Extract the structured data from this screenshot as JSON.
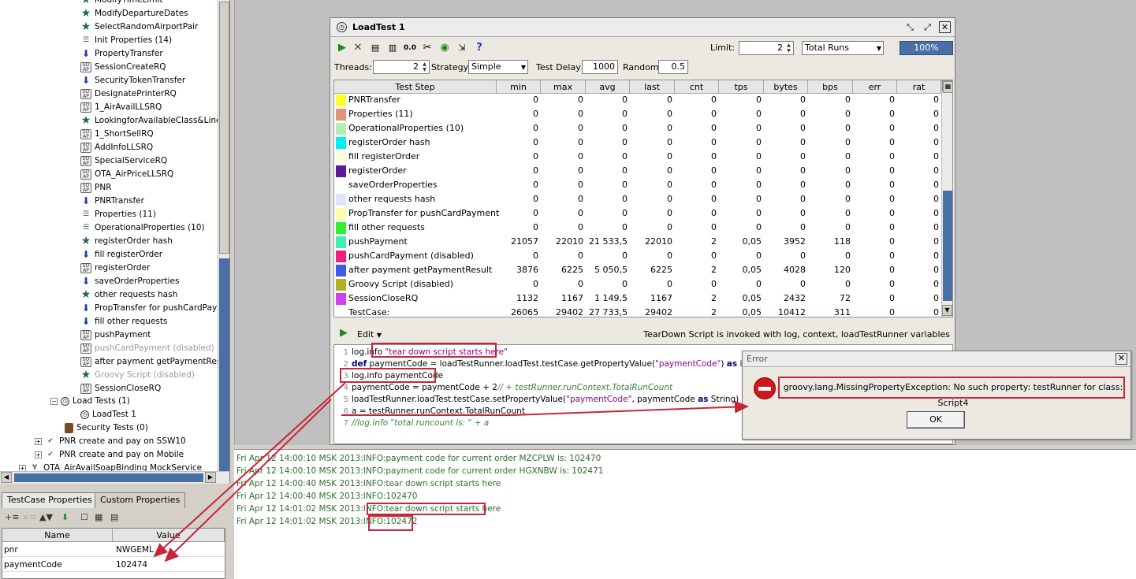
{
  "navigator": {
    "items": [
      {
        "label": "ModifyTimeLimit",
        "icon": "star-icon",
        "state": "normal"
      },
      {
        "label": "ModifyDepartureDates",
        "icon": "star-icon",
        "state": "normal"
      },
      {
        "label": "SelectRandomAirportPair",
        "icon": "star-icon",
        "state": "normal"
      },
      {
        "label": "Init Properties (14)",
        "icon": "properties-icon",
        "state": "normal"
      },
      {
        "label": "PropertyTransfer",
        "icon": "transfer-icon",
        "state": "normal"
      },
      {
        "label": "SessionCreateRQ",
        "icon": "soap-icon",
        "state": "normal"
      },
      {
        "label": "SecurityTokenTransfer",
        "icon": "transfer-icon",
        "state": "normal"
      },
      {
        "label": "DesignatePrinterRQ",
        "icon": "soap-icon",
        "state": "normal"
      },
      {
        "label": "1_AirAvailLLSRQ",
        "icon": "soap-icon",
        "state": "normal"
      },
      {
        "label": "LookingforAvailableClass&Linenu",
        "icon": "star-icon",
        "state": "normal"
      },
      {
        "label": "1_ShortSellRQ",
        "icon": "soap-icon",
        "state": "normal"
      },
      {
        "label": "AddInfoLLSRQ",
        "icon": "soap-icon",
        "state": "normal"
      },
      {
        "label": "SpecialServiceRQ",
        "icon": "soap-icon",
        "state": "normal"
      },
      {
        "label": "OTA_AirPriceLLSRQ",
        "icon": "soap-icon",
        "state": "normal"
      },
      {
        "label": "PNR",
        "icon": "soap-icon",
        "state": "normal"
      },
      {
        "label": "PNRTransfer",
        "icon": "transfer-icon",
        "state": "normal"
      },
      {
        "label": "Properties (11)",
        "icon": "properties-icon",
        "state": "normal"
      },
      {
        "label": "OperationalProperties (10)",
        "icon": "properties-icon",
        "state": "normal"
      },
      {
        "label": "registerOrder hash",
        "icon": "star-icon",
        "state": "normal"
      },
      {
        "label": "fill registerOrder",
        "icon": "transfer-icon",
        "state": "normal"
      },
      {
        "label": "registerOrder",
        "icon": "soap-icon",
        "state": "normal"
      },
      {
        "label": "saveOrderProperties",
        "icon": "transfer-icon",
        "state": "normal"
      },
      {
        "label": "other requests hash",
        "icon": "star-icon",
        "state": "normal"
      },
      {
        "label": "PropTransfer for pushCardPaym",
        "icon": "transfer-icon",
        "state": "normal"
      },
      {
        "label": "fill other requests",
        "icon": "transfer-icon",
        "state": "normal"
      },
      {
        "label": "pushPayment",
        "icon": "soap-icon",
        "state": "normal"
      },
      {
        "label": "pushCardPayment (disabled)",
        "icon": "soap-icon",
        "state": "disabled"
      },
      {
        "label": "after payment getPaymentResu",
        "icon": "soap-icon",
        "state": "normal"
      },
      {
        "label": "Groovy Script (disabled)",
        "icon": "star-icon",
        "state": "disabled"
      },
      {
        "label": "SessionCloseRQ",
        "icon": "soap-icon",
        "state": "normal"
      }
    ],
    "load_tests": "Load Tests (1)",
    "load_test_item": "LoadTest 1",
    "security_tests": "Security Tests (0)",
    "testcase_a": "PNR create and pay on SSW10",
    "testcase_b": "PNR create and pay on Mobile",
    "mock_service": "OTA_AirAvailSoapBinding MockService"
  },
  "props_panel": {
    "tab_testcase": "TestCase Properties",
    "tab_custom": "Custom Properties",
    "col_name": "Name",
    "col_value": "Value",
    "rows": [
      {
        "name": "pnr",
        "value": "NWGEML"
      },
      {
        "name": "paymentCode",
        "value": "102474"
      }
    ]
  },
  "load_test": {
    "title": "LoadTest 1",
    "limit_label": "Limit:",
    "limit_value": "2",
    "limit_type": "Total Runs",
    "progress": "100%",
    "threads_label": "Threads:",
    "threads_value": "2",
    "strategy_label": "Strategy",
    "strategy_value": "Simple",
    "test_delay_label": "Test Delay",
    "test_delay_value": "1000",
    "random_label": "Random",
    "random_value": "0.5",
    "columns": [
      "Test Step",
      "min",
      "max",
      "avg",
      "last",
      "cnt",
      "tps",
      "bytes",
      "bps",
      "err",
      "rat"
    ],
    "rows": [
      {
        "color": "#ffff30",
        "name": "PNRTransfer",
        "v": [
          "0",
          "0",
          "0",
          "0",
          "0",
          "0",
          "0",
          "0",
          "0",
          "0"
        ]
      },
      {
        "color": "#e0957a",
        "name": "Properties (11)",
        "v": [
          "0",
          "0",
          "0",
          "0",
          "0",
          "0",
          "0",
          "0",
          "0",
          "0"
        ]
      },
      {
        "color": "#b2f0b2",
        "name": "OperationalProperties (10)",
        "v": [
          "0",
          "0",
          "0",
          "0",
          "0",
          "0",
          "0",
          "0",
          "0",
          "0"
        ]
      },
      {
        "color": "#00f0f0",
        "name": "registerOrder hash",
        "v": [
          "0",
          "0",
          "0",
          "0",
          "0",
          "0",
          "0",
          "0",
          "0",
          "0"
        ]
      },
      {
        "color": "#ffffe0",
        "name": "fill registerOrder",
        "v": [
          "0",
          "0",
          "0",
          "0",
          "0",
          "0",
          "0",
          "0",
          "0",
          "0"
        ]
      },
      {
        "color": "#5a1a9a",
        "name": "registerOrder",
        "v": [
          "0",
          "0",
          "0",
          "0",
          "0",
          "0",
          "0",
          "0",
          "0",
          "0"
        ]
      },
      {
        "color": "#ffffff",
        "name": "saveOrderProperties",
        "v": [
          "0",
          "0",
          "0",
          "0",
          "0",
          "0",
          "0",
          "0",
          "0",
          "0"
        ]
      },
      {
        "color": "#dce6f8",
        "name": "other requests hash",
        "v": [
          "0",
          "0",
          "0",
          "0",
          "0",
          "0",
          "0",
          "0",
          "0",
          "0"
        ]
      },
      {
        "color": "#ffffa8",
        "name": "PropTransfer for pushCardPayment",
        "v": [
          "0",
          "0",
          "0",
          "0",
          "0",
          "0",
          "0",
          "0",
          "0",
          "0"
        ]
      },
      {
        "color": "#30f030",
        "name": "fill other requests",
        "v": [
          "0",
          "0",
          "0",
          "0",
          "0",
          "0",
          "0",
          "0",
          "0",
          "0"
        ]
      },
      {
        "color": "#40f0b0",
        "name": "pushPayment",
        "v": [
          "21057",
          "22010",
          "21 533,5",
          "22010",
          "2",
          "0,05",
          "3952",
          "118",
          "0",
          "0"
        ]
      },
      {
        "color": "#f02080",
        "name": "pushCardPayment (disabled)",
        "v": [
          "0",
          "0",
          "0",
          "0",
          "0",
          "0",
          "0",
          "0",
          "0",
          "0"
        ]
      },
      {
        "color": "#3a5ae8",
        "name": "after payment getPaymentResult",
        "v": [
          "3876",
          "6225",
          "5 050,5",
          "6225",
          "2",
          "0,05",
          "4028",
          "120",
          "0",
          "0"
        ]
      },
      {
        "color": "#b0b020",
        "name": "Groovy Script (disabled)",
        "v": [
          "0",
          "0",
          "0",
          "0",
          "0",
          "0",
          "0",
          "0",
          "0",
          "0"
        ]
      },
      {
        "color": "#d040f0",
        "name": "SessionCloseRQ",
        "v": [
          "1132",
          "1167",
          "1 149,5",
          "1167",
          "2",
          "0,05",
          "2432",
          "72",
          "0",
          "0"
        ]
      },
      {
        "color": "#ffffff",
        "name": "TestCase:",
        "v": [
          "26065",
          "29402",
          "27 733,5",
          "29402",
          "2",
          "0,05",
          "10412",
          "311",
          "0",
          "0"
        ]
      }
    ],
    "edit_label": "Edit",
    "teardown_info": "TearDown Script is invoked with log, context, loadTestRunner variables",
    "script_lines": [
      "log.info \"tear down script starts here\"",
      "def paymentCode = loadTestRunner.loadTest.testCase.getPropertyValue(\"paymentCode\") as int",
      "log.info paymentCode",
      "paymentCode = paymentCode + 2// + testRunner.runContext.TotalRunCount",
      "loadTestRunner.loadTest.testCase.setPropertyValue(\"paymentCode\", paymentCode as String)",
      "a = testRunner.runContext.TotalRunCount",
      "//log.info \"total runcount is: \" + a"
    ]
  },
  "log": [
    "Fri Apr 12 14:00:10 MSK 2013:INFO:payment code for current order MZCPLW is: 102470",
    "Fri Apr 12 14:00:10 MSK 2013:INFO:payment code for current order HGXNBW is: 102471",
    "Fri Apr 12 14:00:40 MSK 2013:INFO:tear down script starts here",
    "Fri Apr 12 14:00:40 MSK 2013:INFO:102470",
    "Fri Apr 12 14:01:02 MSK 2013:INFO:tear down script starts here",
    "Fri Apr 12 14:01:02 MSK 2013:INFO:102472"
  ],
  "error_dialog": {
    "title": "Error",
    "message": "groovy.lang.MissingPropertyException: No such property: testRunner for class: Script4",
    "ok": "OK"
  },
  "colors": {
    "accent": "#4a6fa5",
    "annotation": "#c8243a",
    "log_text": "#2e6e2e"
  }
}
